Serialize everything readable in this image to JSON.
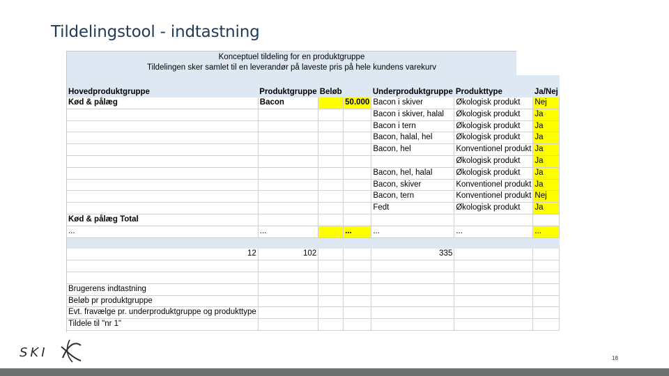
{
  "slide": {
    "title": "Tildelingstool - indtastning",
    "page_number": "18",
    "logo_text": "SKI"
  },
  "sheet": {
    "title_line1": "Konceptuel tildeling for en produktgruppe",
    "title_line2": "Tildelingen sker samlet til en leverandør på laveste pris på hele kundens varekurv",
    "headers": [
      "Hovedproduktgruppe",
      "Produktgruppe",
      "Beløb",
      "",
      "Underproduktgruppe",
      "Produkttype",
      "Ja/Nej"
    ],
    "rows": [
      [
        "Kød & pålæg",
        "Bacon",
        "",
        "50.000",
        "Bacon i skiver",
        "Økologisk produkt",
        "Nej"
      ],
      [
        "",
        "",
        "",
        "",
        "Bacon i skiver, halal",
        "Økologisk produkt",
        "Ja"
      ],
      [
        "",
        "",
        "",
        "",
        "Bacon i tern",
        "Økologisk produkt",
        "Ja"
      ],
      [
        "",
        "",
        "",
        "",
        "Bacon, halal, hel",
        "Økologisk produkt",
        "Ja"
      ],
      [
        "",
        "",
        "",
        "",
        "Bacon, hel",
        "Konventionel produkt",
        "Ja"
      ],
      [
        "",
        "",
        "",
        "",
        "",
        "Økologisk produkt",
        "Ja"
      ],
      [
        "",
        "",
        "",
        "",
        "Bacon, hel, halal",
        "Økologisk produkt",
        "Ja"
      ],
      [
        "",
        "",
        "",
        "",
        "Bacon, skiver",
        "Konventionel produkt",
        "Ja"
      ],
      [
        "",
        "",
        "",
        "",
        "Bacon, tern",
        "Konventionel produkt",
        "Nej"
      ],
      [
        "",
        "",
        "",
        "",
        "Fedt",
        "Økologisk produkt",
        "Ja"
      ]
    ],
    "total_label": "Kød & pålæg Total",
    "ellipsis_row": [
      "...",
      "...",
      "",
      "...",
      "...",
      "...",
      "..."
    ],
    "counts": [
      "12",
      "102",
      "",
      "",
      "335",
      "",
      ""
    ],
    "notes": [
      "Brugerens indtastning",
      "Beløb pr produktgruppe",
      "Evt. fravælge pr. underproduktgruppe og produkttype",
      "Tildele til \"nr 1\""
    ]
  },
  "colors": {
    "header_band": "#dde8f2",
    "highlight": "#ffff00",
    "title_text": "#1f3b57",
    "footer_bar": "#6b7170"
  }
}
